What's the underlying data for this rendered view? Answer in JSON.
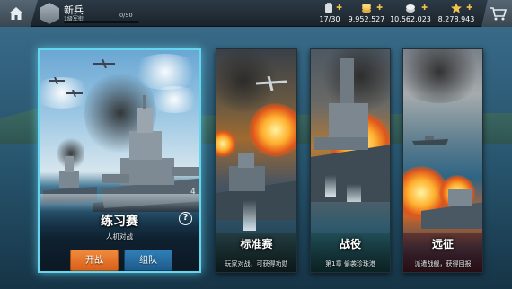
{
  "player": {
    "name": "新兵",
    "rank": "1级军衔",
    "xp_text": "0/50",
    "xp_progress": 0
  },
  "resources": [
    {
      "name": "fuel",
      "icon": "fuel-icon",
      "value": "17/30"
    },
    {
      "name": "silver",
      "icon": "silver-coins-icon",
      "value": "9,952,527"
    },
    {
      "name": "credits",
      "icon": "credits-icon",
      "value": "10,562,023"
    },
    {
      "name": "gold",
      "icon": "star-gold-icon",
      "value": "8,278,943"
    }
  ],
  "modes": {
    "practice": {
      "title": "练习赛",
      "subtitle": "人机对战",
      "start_label": "开战",
      "team_label": "组队",
      "help": "?"
    },
    "pvp": {
      "title": "标准赛",
      "subtitle": "玩家对战，可获得功勋"
    },
    "campaign": {
      "title": "战役",
      "subtitle": "第1章  偷袭珍珠港"
    },
    "expedition": {
      "title": "远征",
      "subtitle": "派遣战舰，获得回报"
    }
  },
  "colors": {
    "highlight": "#66d6f0",
    "start_button": "#e8742a",
    "team_button": "#2a70a6",
    "currency_plus": "#f4c24a"
  }
}
